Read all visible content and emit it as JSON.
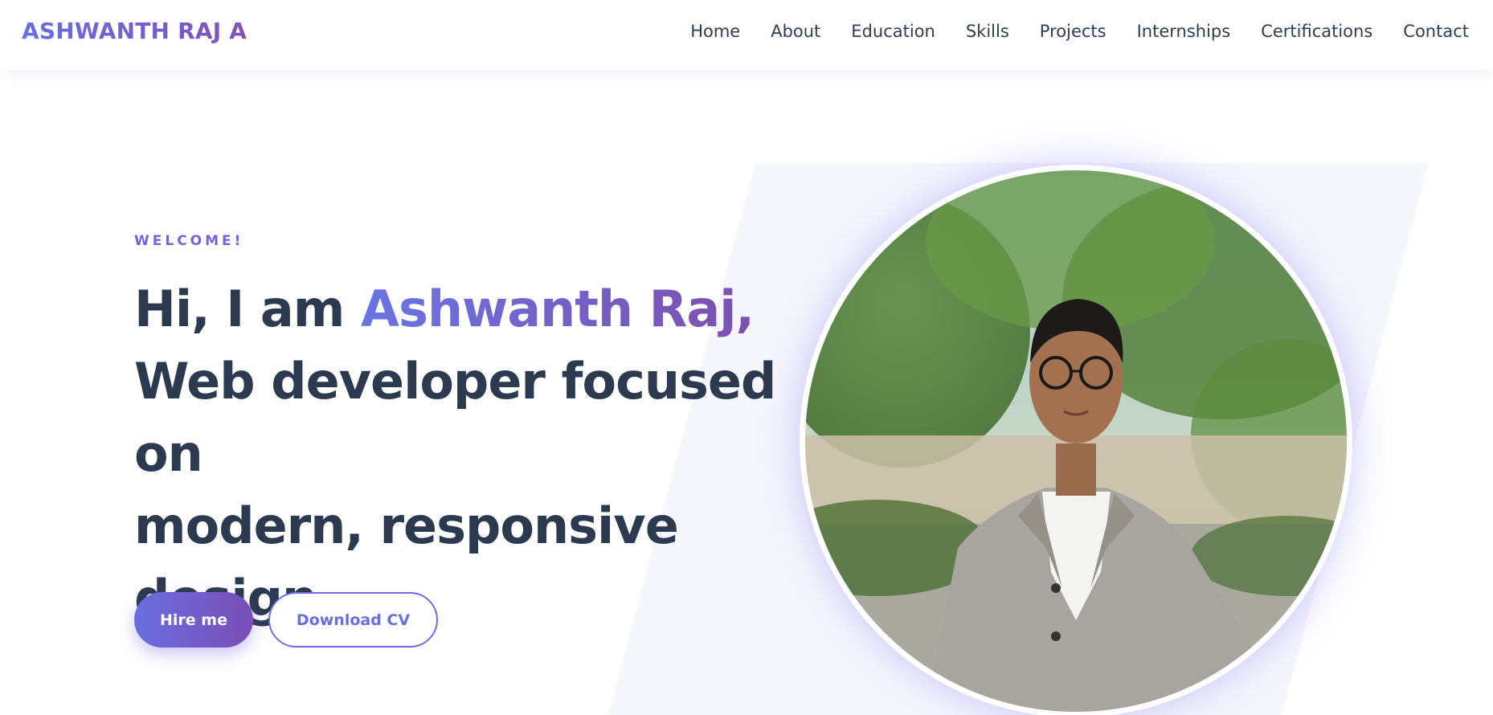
{
  "brand": {
    "name": "ASHWANTH RAJ A"
  },
  "nav": {
    "items": [
      {
        "label": "Home"
      },
      {
        "label": "About"
      },
      {
        "label": "Education"
      },
      {
        "label": "Skills"
      },
      {
        "label": "Projects"
      },
      {
        "label": "Internships"
      },
      {
        "label": "Certifications"
      },
      {
        "label": "Contact"
      }
    ]
  },
  "hero": {
    "welcome": "WELCOME!",
    "intro": "Hi, I am ",
    "name": "Ashwanth Raj,",
    "line2": "Web developer focused on",
    "line3": "modern, responsive",
    "line4": "design.",
    "hire_label": "Hire me",
    "cv_label": "Download CV"
  },
  "colors": {
    "accent_start": "#6a6ee0",
    "accent_end": "#7a4eb6",
    "text_dark": "#2c3a4f",
    "shape_bg": "#f6f6fd"
  },
  "icons": {
    "portrait": "profile-photo"
  }
}
